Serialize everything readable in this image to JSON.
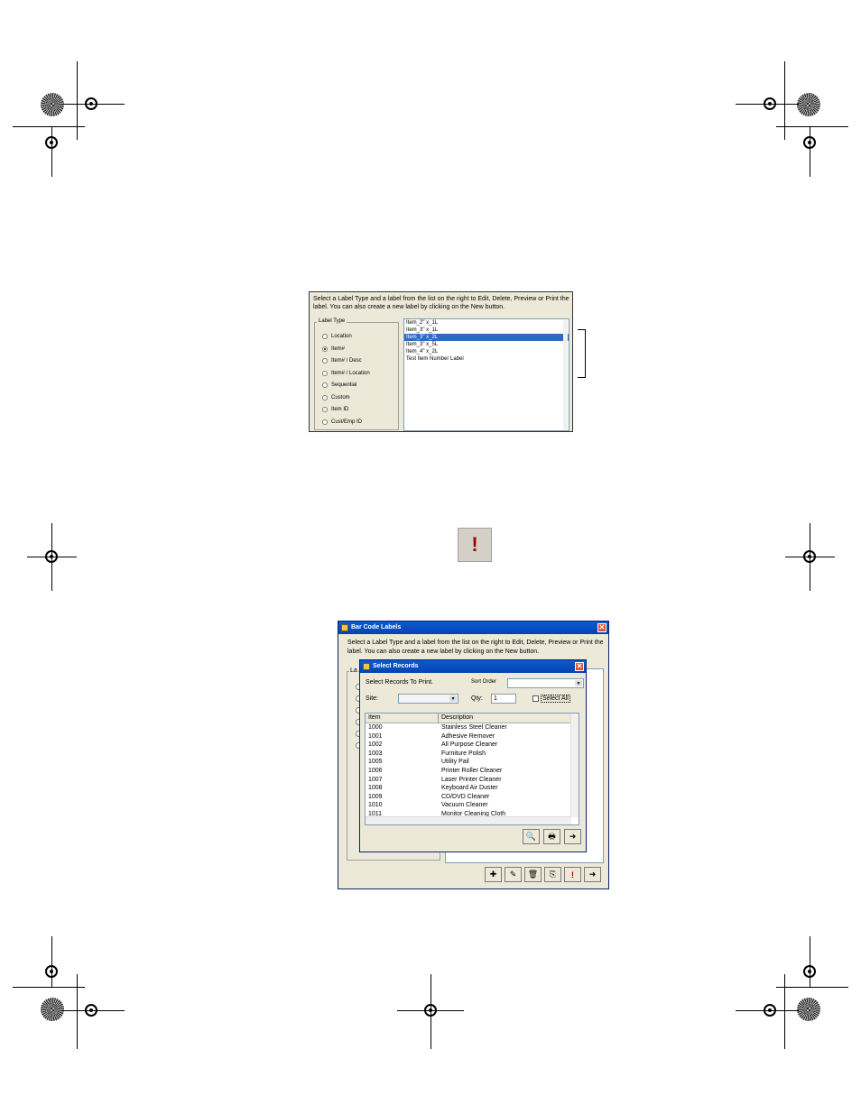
{
  "label_panel": {
    "intro": "Select a Label Type and a label from the list on the right to Edit, Delete, Preview or Print the label. You can also create a new label by clicking on the New button.",
    "group_title": "Label Type",
    "label_types": [
      "Location",
      "Item#",
      "Item# / Desc",
      "Item# / Location",
      "Sequential",
      "Custom",
      "Item ID",
      "Cust/Emp ID"
    ],
    "selected_type": "Item#",
    "labels": [
      "Item_2\" x_1L",
      "Item_3\" x_1L",
      "Item_3\" x_2L",
      "Item_3\" x_5L",
      "Item_4\" x_2L",
      "Test Item Number Label"
    ],
    "selected_label": "Item_3\" x_2L"
  },
  "print_button": {
    "icon": "exclamation-icon",
    "glyph": "!"
  },
  "window": {
    "title": "Bar Code Labels",
    "intro": "Select a Label Type and a label from the list on the right to Edit, Delete, Preview or Print the label. You can also create a new label by clicking on the New button.",
    "group_title_partial": "La",
    "toolbar_icons": [
      "new-icon",
      "edit-icon",
      "delete-icon",
      "preview-icon",
      "print-icon",
      "exit-icon"
    ],
    "toolbar_glyphs": [
      "✚",
      "✎",
      "🗑",
      "⎘",
      "!",
      "➜"
    ]
  },
  "dialog": {
    "title": "Select Records",
    "prompt": "Select Records To Print.",
    "sort_order_label": "Sort Order",
    "sort_order_value": "",
    "site_label": "Site:",
    "site_value": "",
    "qty_label": "Qty:",
    "qty_value": "1",
    "select_all_label": "Select All",
    "select_all_checked": false,
    "columns": [
      "Item",
      "Description"
    ],
    "rows": [
      [
        "1000",
        "Stainless Steel Cleaner"
      ],
      [
        "1001",
        "Adhesive Remover"
      ],
      [
        "1002",
        "All Purpose Cleaner"
      ],
      [
        "1003",
        "Furniture Polish"
      ],
      [
        "1005",
        "Utility Pail"
      ],
      [
        "1006",
        "Printer Roller Cleaner"
      ],
      [
        "1007",
        "Laser Printer Cleaner"
      ],
      [
        "1008",
        "Keyboard Air Duster"
      ],
      [
        "1009",
        "CD/DVD Cleaner"
      ],
      [
        "1010",
        "Vacuum Cleaner"
      ],
      [
        "1011",
        "Monitor Cleaning Cloth"
      ]
    ],
    "buttons": [
      "preview-icon",
      "print-icon",
      "exit-icon"
    ],
    "button_glyphs": [
      "🔍",
      "🖶",
      "➜"
    ]
  },
  "colors": {
    "selection": "#316ac5",
    "titlebar": "#0a5ad4",
    "face": "#ece9d8",
    "exclamation": "#a00000"
  }
}
